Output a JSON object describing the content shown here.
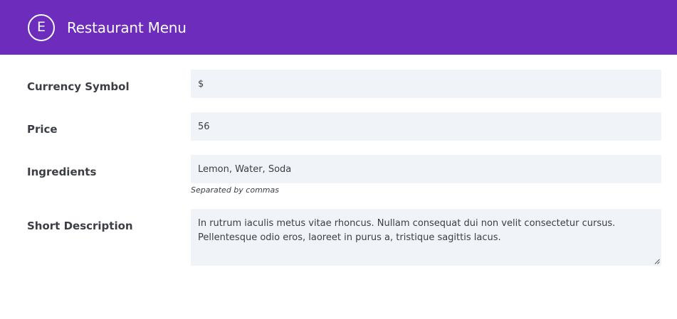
{
  "header": {
    "logo_letter": "E",
    "title": "Restaurant Menu",
    "background": "#6d2cbc"
  },
  "fields": {
    "currency_symbol": {
      "label": "Currency Symbol",
      "value": "$"
    },
    "price": {
      "label": "Price",
      "value": "56"
    },
    "ingredients": {
      "label": "Ingredients",
      "value": "Lemon, Water, Soda",
      "help": "Separated by commas"
    },
    "short_description": {
      "label": "Short Description",
      "value": "In rutrum iaculis metus vitae rhoncus. Nullam consequat dui non velit consectetur cursus. Pellentesque odio eros, laoreet in purus a, tristique sagittis lacus."
    }
  }
}
